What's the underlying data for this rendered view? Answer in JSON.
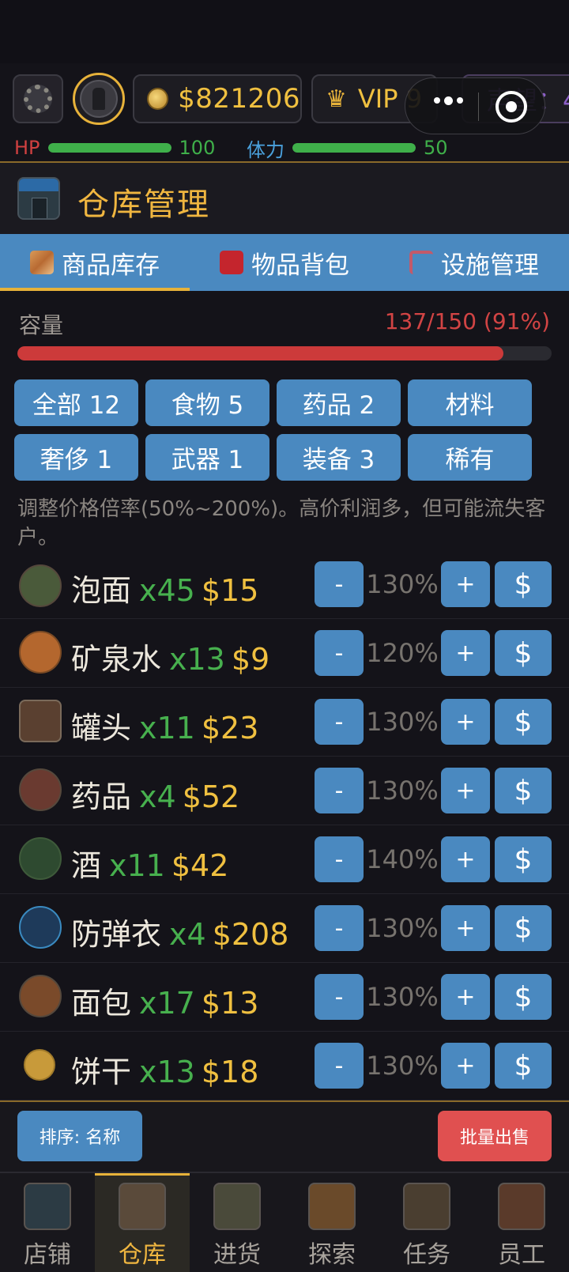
{
  "status": {
    "money": "$821206",
    "vip": "VIP 9",
    "reputation": "声望：4",
    "hp_label": "HP",
    "hp_value": "100",
    "hp_fraction": 1.0,
    "stamina_label": "体力",
    "stamina_value": "50",
    "stamina_fraction": 1.0
  },
  "header": {
    "title": "仓库管理"
  },
  "tabs": [
    {
      "label": "商品库存",
      "icon": "box-icon",
      "active": true
    },
    {
      "label": "物品背包",
      "icon": "backpack-icon",
      "active": false
    },
    {
      "label": "设施管理",
      "icon": "crane-icon",
      "active": false
    }
  ],
  "capacity": {
    "label": "容量",
    "value": "137/150 (91%)",
    "fraction": 0.91
  },
  "filters": [
    {
      "label": "全部 12"
    },
    {
      "label": "食物 5"
    },
    {
      "label": "药品 2"
    },
    {
      "label": "材料"
    },
    {
      "label": "奢侈 1"
    },
    {
      "label": "武器 1"
    },
    {
      "label": "装备 3"
    },
    {
      "label": "稀有"
    }
  ],
  "hint": "调整价格倍率(50%~200%)。高价利润多，但可能流失客户。",
  "controls": {
    "minus": "-",
    "plus": "+",
    "sell": "$"
  },
  "items": [
    {
      "name": "泡面",
      "qty": "x45",
      "price": "$15",
      "pct": "130%",
      "icon": "noodles-icon"
    },
    {
      "name": "矿泉水",
      "qty": "x13",
      "price": "$9",
      "pct": "120%",
      "icon": "water-drop-icon"
    },
    {
      "name": "罐头",
      "qty": "x11",
      "price": "$23",
      "pct": "130%",
      "icon": "can-icon"
    },
    {
      "name": "药品",
      "qty": "x4",
      "price": "$52",
      "pct": "130%",
      "icon": "pill-icon"
    },
    {
      "name": "酒",
      "qty": "x11",
      "price": "$42",
      "pct": "140%",
      "icon": "bottle-icon"
    },
    {
      "name": "防弹衣",
      "qty": "x4",
      "price": "$208",
      "pct": "130%",
      "icon": "shield-icon"
    },
    {
      "name": "面包",
      "qty": "x17",
      "price": "$13",
      "pct": "130%",
      "icon": "bread-icon"
    },
    {
      "name": "饼干",
      "qty": "x13",
      "price": "$18",
      "pct": "130%",
      "icon": "cookie-icon"
    }
  ],
  "bottom": {
    "sort": "排序: 名称",
    "batch_sell": "批量出售"
  },
  "nav": [
    {
      "label": "店铺",
      "icon": "shop-icon",
      "active": false
    },
    {
      "label": "仓库",
      "icon": "warehouse-icon",
      "active": true
    },
    {
      "label": "进货",
      "icon": "truck-icon",
      "active": false
    },
    {
      "label": "探索",
      "icon": "map-icon",
      "active": false
    },
    {
      "label": "任务",
      "icon": "clipboard-icon",
      "active": false
    },
    {
      "label": "员工",
      "icon": "team-icon",
      "active": false
    }
  ],
  "colors": {
    "accent_gold": "#f0b640",
    "button_blue": "#4a89c0",
    "danger_red": "#e05050",
    "qty_green": "#47b04e"
  }
}
